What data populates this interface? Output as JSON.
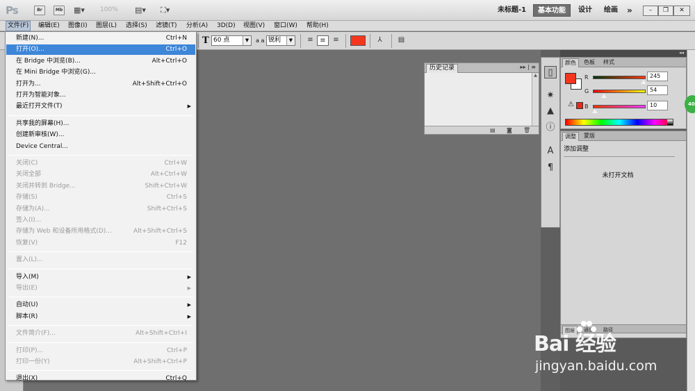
{
  "app": {
    "logo": "Ps",
    "zoom": "100%",
    "workspace_doc": "未标题-1",
    "workspaces": [
      "基本功能",
      "设计",
      "绘画"
    ],
    "more": "»"
  },
  "titlebar_buttons": {
    "br": "Br",
    "mb": "Mb"
  },
  "menubar": [
    "文件(F)",
    "编辑(E)",
    "图像(I)",
    "图层(L)",
    "选择(S)",
    "滤镜(T)",
    "分析(A)",
    "3D(D)",
    "视图(V)",
    "窗口(W)",
    "帮助(H)"
  ],
  "options": {
    "font_size": "60 点",
    "aa_icon": "a a",
    "antialias": "锐利",
    "text_color": "#f5361e"
  },
  "file_menu": [
    {
      "label": "新建(N)...",
      "shortcut": "Ctrl+N",
      "state": "normal"
    },
    {
      "label": "打开(O)...",
      "shortcut": "Ctrl+O",
      "state": "highlight"
    },
    {
      "label": "在 Bridge 中浏览(B)...",
      "shortcut": "Alt+Ctrl+O",
      "state": "normal"
    },
    {
      "label": "在 Mini Bridge 中浏览(G)...",
      "shortcut": "",
      "state": "normal"
    },
    {
      "label": "打开为...",
      "shortcut": "Alt+Shift+Ctrl+O",
      "state": "normal"
    },
    {
      "label": "打开为智能对象...",
      "shortcut": "",
      "state": "normal"
    },
    {
      "label": "最近打开文件(T)",
      "shortcut": "",
      "state": "normal",
      "submenu": true
    },
    {
      "sep": true
    },
    {
      "label": "共享我的屏幕(H)...",
      "shortcut": "",
      "state": "normal"
    },
    {
      "label": "创建新审核(W)...",
      "shortcut": "",
      "state": "normal"
    },
    {
      "label": "Device Central...",
      "shortcut": "",
      "state": "normal"
    },
    {
      "sep": true
    },
    {
      "label": "关闭(C)",
      "shortcut": "Ctrl+W",
      "state": "disabled"
    },
    {
      "label": "关闭全部",
      "shortcut": "Alt+Ctrl+W",
      "state": "disabled"
    },
    {
      "label": "关闭并转到 Bridge...",
      "shortcut": "Shift+Ctrl+W",
      "state": "disabled"
    },
    {
      "label": "存储(S)",
      "shortcut": "Ctrl+S",
      "state": "disabled"
    },
    {
      "label": "存储为(A)...",
      "shortcut": "Shift+Ctrl+S",
      "state": "disabled"
    },
    {
      "label": "签入(I)...",
      "shortcut": "",
      "state": "disabled"
    },
    {
      "label": "存储为 Web 和设备所用格式(D)...",
      "shortcut": "Alt+Shift+Ctrl+S",
      "state": "disabled"
    },
    {
      "label": "恢复(V)",
      "shortcut": "F12",
      "state": "disabled"
    },
    {
      "sep": true
    },
    {
      "label": "置入(L)...",
      "shortcut": "",
      "state": "disabled"
    },
    {
      "sep": true
    },
    {
      "label": "导入(M)",
      "shortcut": "",
      "state": "normal",
      "submenu": true
    },
    {
      "label": "导出(E)",
      "shortcut": "",
      "state": "disabled",
      "submenu": true
    },
    {
      "sep": true
    },
    {
      "label": "自动(U)",
      "shortcut": "",
      "state": "normal",
      "submenu": true
    },
    {
      "label": "脚本(R)",
      "shortcut": "",
      "state": "normal",
      "submenu": true
    },
    {
      "sep": true
    },
    {
      "label": "文件简介(F)...",
      "shortcut": "Alt+Shift+Ctrl+I",
      "state": "disabled"
    },
    {
      "sep": true
    },
    {
      "label": "打印(P)...",
      "shortcut": "Ctrl+P",
      "state": "disabled"
    },
    {
      "label": "打印一份(Y)",
      "shortcut": "Alt+Shift+Ctrl+P",
      "state": "disabled"
    },
    {
      "sep": true
    },
    {
      "label": "退出(X)",
      "shortcut": "Ctrl+Q",
      "state": "normal"
    }
  ],
  "history_panel": {
    "tab": "历史记录"
  },
  "color_panel": {
    "tabs": [
      "颜色",
      "色板",
      "样式"
    ],
    "r_label": "R",
    "g_label": "G",
    "b_label": "B",
    "r": "245",
    "g": "54",
    "b": "10",
    "r_fraction": 0.96,
    "g_fraction": 0.21,
    "b_fraction": 0.04
  },
  "adjust_panel": {
    "tabs": [
      "调整",
      "蒙版"
    ],
    "title": "添加调整",
    "message": "未打开文档"
  },
  "layers_panel": {
    "tabs": [
      "图层",
      "通道",
      "路径"
    ]
  },
  "badge": "40",
  "watermark": {
    "main": "Bai 经验",
    "sub": "jingyan.baidu.com"
  }
}
